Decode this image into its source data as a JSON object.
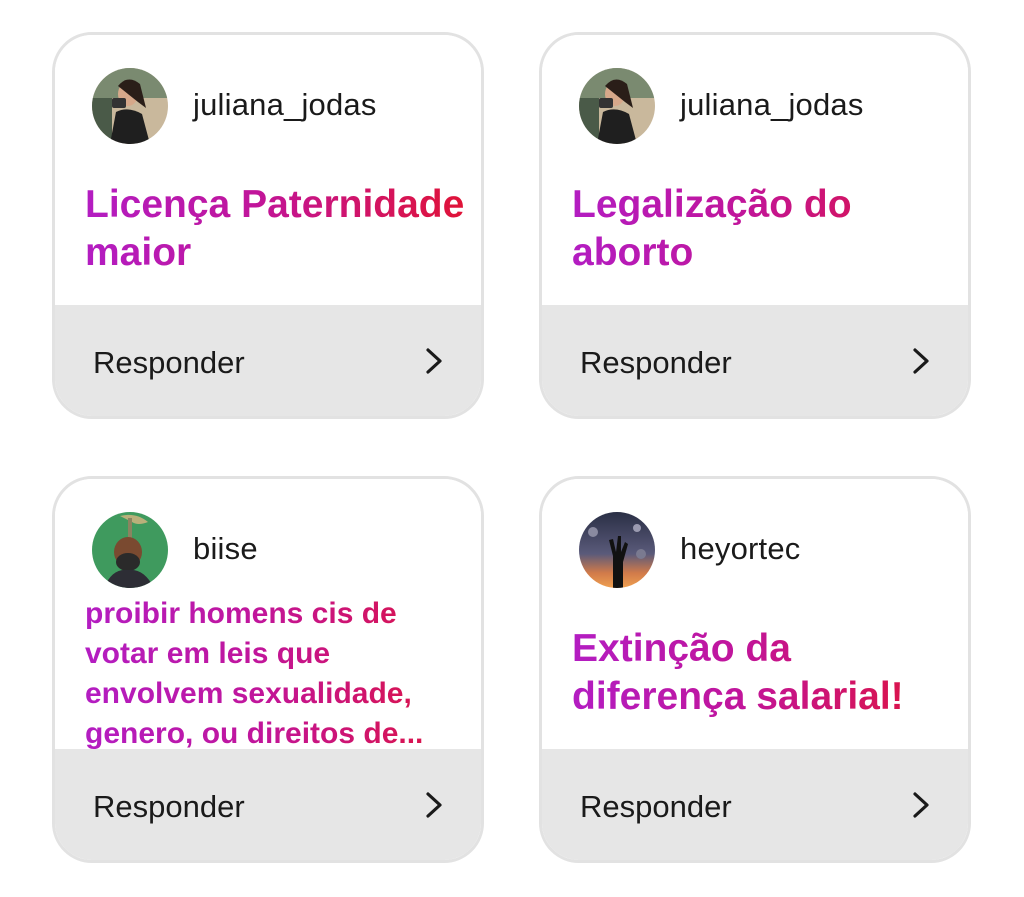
{
  "cards": [
    {
      "username": "juliana_jodas",
      "avatar": "profile-photo",
      "question": "Licença Paternidade maior",
      "action_label": "Responder"
    },
    {
      "username": "juliana_jodas",
      "avatar": "profile-photo",
      "question": "Legalização do aborto",
      "action_label": "Responder"
    },
    {
      "username": "biise",
      "avatar": "profile-photo",
      "question": "proibir homens cis de votar em leis que envolvem sexualidade, genero, ou direitos de...",
      "action_label": "Responder"
    },
    {
      "username": "heyortec",
      "avatar": "profile-photo",
      "question": "Extinção da diferença salarial!",
      "action_label": "Responder"
    }
  ],
  "icons": {
    "action": "chevron-right-icon"
  },
  "colors": {
    "gradient_start": "#b31dc2",
    "gradient_end": "#e01337",
    "card_border": "#e2e2e2",
    "footer_bg": "#e6e6e6"
  }
}
